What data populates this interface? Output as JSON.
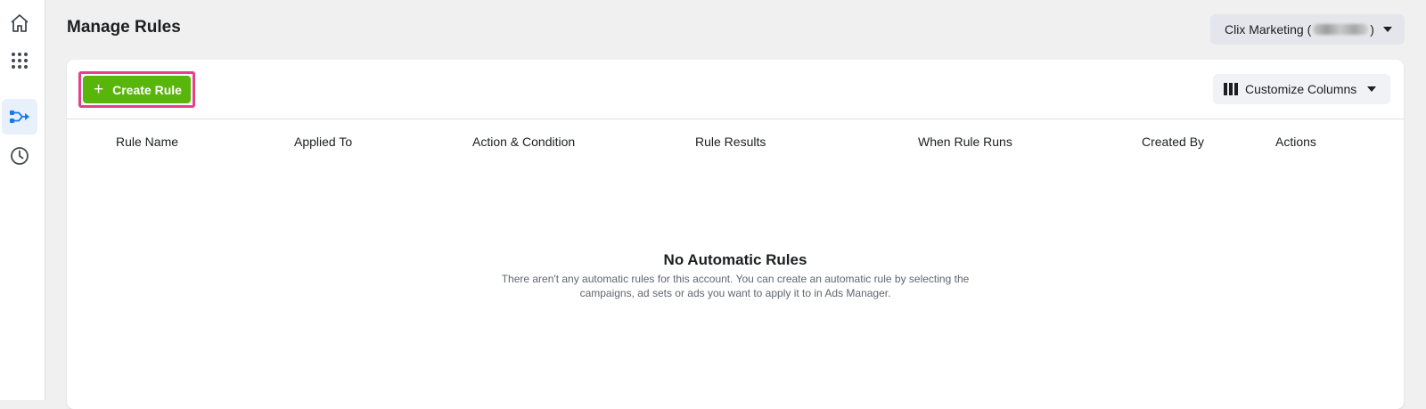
{
  "sidebar": {
    "items": [
      {
        "icon": "home-icon",
        "active": false
      },
      {
        "icon": "grid-icon",
        "active": false
      },
      {
        "icon": "automated-rules-icon",
        "active": true
      },
      {
        "icon": "history-clock-icon",
        "active": false
      }
    ]
  },
  "header": {
    "title": "Manage Rules",
    "account": {
      "prefix": "Clix Marketing (",
      "suffix": ")"
    }
  },
  "toolbar": {
    "create_label": "Create Rule",
    "customize_label": "Customize Columns"
  },
  "table": {
    "columns": [
      "Rule Name",
      "Applied To",
      "Action & Condition",
      "Rule Results",
      "When Rule Runs",
      "Created By",
      "Actions"
    ]
  },
  "empty_state": {
    "title": "No Automatic Rules",
    "description": "There aren't any automatic rules for this account. You can create an automatic rule by selecting the campaigns, ad sets or ads you want to apply it to in Ads Manager."
  },
  "colors": {
    "accent": "#1877f2",
    "create_button": "#58b50a",
    "highlight": "#e83e8c"
  }
}
